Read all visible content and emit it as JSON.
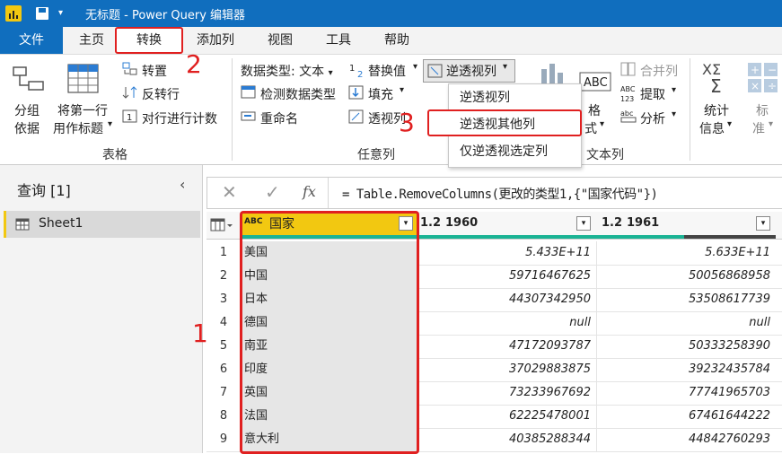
{
  "window": {
    "title": "无标题 - Power Query 编辑器"
  },
  "menu": {
    "tabs": [
      "文件",
      "主页",
      "转换",
      "添加列",
      "视图",
      "工具",
      "帮助"
    ],
    "active": "转换"
  },
  "ribbon": {
    "group_table": {
      "label": "表格",
      "group_by": [
        "分组",
        "依据"
      ],
      "first_row_header": [
        "将第一行",
        "用作标题"
      ],
      "transpose": "转置",
      "reverse_rows": "反转行",
      "count_rows": "对行进行计数"
    },
    "group_any_column": {
      "label": "任意列",
      "data_type": "数据类型: 文本",
      "detect_type": "检测数据类型",
      "rename": "重命名",
      "replace_values": "替换值",
      "fill": "填充",
      "pivot": "透视列",
      "unpivot": "逆透视列"
    },
    "group_text_column": {
      "label": "文本列",
      "merge_columns": "合并列",
      "extract": "提取",
      "parse": "分析",
      "format": [
        "格",
        "式"
      ]
    },
    "group_number": {
      "statistics": [
        "统计",
        "信息"
      ],
      "standard": [
        "标",
        "准"
      ]
    }
  },
  "unpivot_menu": {
    "items": [
      "逆透视列",
      "逆透视其他列",
      "仅逆透视选定列"
    ],
    "highlighted": "逆透视其他列"
  },
  "queries_panel": {
    "title": "查询 [1]",
    "items": [
      "Sheet1"
    ]
  },
  "formula_bar": {
    "fx": "fx",
    "formula": "= Table.RemoveColumns(更改的类型1,{\"国家代码\"})"
  },
  "grid": {
    "columns": [
      {
        "type": "ABC",
        "name": "国家"
      },
      {
        "type": "1.2",
        "name": "1960"
      },
      {
        "type": "1.2",
        "name": "1961"
      }
    ],
    "rows": [
      {
        "n": "1",
        "country": "美国",
        "y1960": "5.433E+11",
        "y1961": "5.633E+11"
      },
      {
        "n": "2",
        "country": "中国",
        "y1960": "59716467625",
        "y1961": "50056868958"
      },
      {
        "n": "3",
        "country": "日本",
        "y1960": "44307342950",
        "y1961": "53508617739"
      },
      {
        "n": "4",
        "country": "德国",
        "y1960": "null",
        "y1961": "null"
      },
      {
        "n": "5",
        "country": "南亚",
        "y1960": "47172093787",
        "y1961": "50333258390"
      },
      {
        "n": "6",
        "country": "印度",
        "y1960": "37029883875",
        "y1961": "39232435784"
      },
      {
        "n": "7",
        "country": "英国",
        "y1960": "73233967692",
        "y1961": "77741965703"
      },
      {
        "n": "8",
        "country": "法国",
        "y1960": "62225478001",
        "y1961": "67461644222"
      },
      {
        "n": "9",
        "country": "意大利",
        "y1960": "40385288344",
        "y1961": "44842760293"
      }
    ]
  },
  "annotations": [
    "1",
    "2",
    "3"
  ],
  "colors": {
    "title_blue": "#106ebe",
    "highlight_red": "#e02020",
    "column_accent": "#f2c811",
    "teal": "#1ab394"
  }
}
